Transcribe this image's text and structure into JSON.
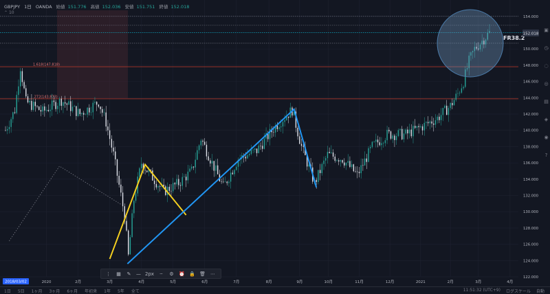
{
  "header": {
    "symbol": "GBPJPY",
    "interval": "1日",
    "broker": "OANDA",
    "open_label": "始値",
    "open_value": "151.776",
    "high_label": "高値",
    "high_value": "152.036",
    "low_label": "安値",
    "low_value": "151.751",
    "close_label": "終値",
    "close_value": "152.018",
    "indicator": "10"
  },
  "toolbar": {
    "width_label": "2px"
  },
  "bottom_bar": {
    "ranges": [
      "1日",
      "5日",
      "1ヶ月",
      "3ヶ月",
      "6ヶ月",
      "年初来",
      "1年",
      "5年",
      "全て"
    ],
    "time": "11:51:32 (UTC+9)",
    "scale_label": "ログスケール",
    "auto_label": "自動"
  },
  "colors": {
    "background": "#131722",
    "grid": "#1e2230",
    "candle_up": "#26a69a",
    "candle_down": "#e0e3eb",
    "fib_line": "#c0392b",
    "price_line": "#00bcd4",
    "yellow": "#f5d020",
    "blue": "#2196f3"
  },
  "chart_data": {
    "type": "candlestick",
    "instrument": "GBPJPY",
    "timeframe": "1日",
    "x_axis": {
      "ticks": [
        "2018/03/02",
        "2020",
        "2月",
        "3月",
        "4月",
        "5月",
        "6月",
        "7月",
        "8月",
        "9月",
        "10月",
        "11月",
        "12月",
        "2021",
        "2月",
        "3月",
        "4月"
      ]
    },
    "y_axis": {
      "range": [
        122,
        155
      ],
      "ticks": [
        122,
        124,
        126,
        128,
        130,
        132,
        134,
        136,
        138,
        140,
        142,
        144,
        146,
        148,
        150,
        152,
        154
      ],
      "label_format": "0.000"
    },
    "last_price": "152.018",
    "series": [
      {
        "name": "",
        "anchors": [
          {
            "t": 0,
            "v": 140.0
          },
          {
            "t": 10,
            "v": 142.5
          },
          {
            "t": 16,
            "v": 147.8
          },
          {
            "t": 22,
            "v": 143.5
          },
          {
            "t": 40,
            "v": 142.3
          },
          {
            "t": 60,
            "v": 143.7
          },
          {
            "t": 80,
            "v": 142.0
          },
          {
            "t": 100,
            "v": 143.5
          },
          {
            "t": 108,
            "v": 141.0
          },
          {
            "t": 116,
            "v": 137.0
          },
          {
            "t": 128,
            "v": 129.5
          },
          {
            "t": 132,
            "v": 124.5
          },
          {
            "t": 138,
            "v": 131.5
          },
          {
            "t": 146,
            "v": 136.0
          },
          {
            "t": 156,
            "v": 134.5
          },
          {
            "t": 170,
            "v": 132.5
          },
          {
            "t": 186,
            "v": 133.5
          },
          {
            "t": 200,
            "v": 135.0
          },
          {
            "t": 210,
            "v": 139.0
          },
          {
            "t": 222,
            "v": 136.0
          },
          {
            "t": 234,
            "v": 133.0
          },
          {
            "t": 250,
            "v": 136.5
          },
          {
            "t": 270,
            "v": 137.5
          },
          {
            "t": 290,
            "v": 140.5
          },
          {
            "t": 308,
            "v": 142.5
          },
          {
            "t": 318,
            "v": 138.0
          },
          {
            "t": 332,
            "v": 133.5
          },
          {
            "t": 346,
            "v": 137.0
          },
          {
            "t": 362,
            "v": 136.5
          },
          {
            "t": 378,
            "v": 134.5
          },
          {
            "t": 394,
            "v": 138.0
          },
          {
            "t": 410,
            "v": 139.5
          },
          {
            "t": 430,
            "v": 139.5
          },
          {
            "t": 448,
            "v": 140.5
          },
          {
            "t": 464,
            "v": 141.5
          },
          {
            "t": 478,
            "v": 143.0
          },
          {
            "t": 486,
            "v": 144.5
          },
          {
            "t": 492,
            "v": 146.0
          },
          {
            "t": 498,
            "v": 148.5
          },
          {
            "t": 504,
            "v": 150.0
          },
          {
            "t": 512,
            "v": 151.0
          },
          {
            "t": 520,
            "v": 152.0
          }
        ]
      }
    ],
    "annotations": {
      "fib_levels": [
        {
          "label": "1.618(147.818)",
          "value": 147.818
        },
        {
          "label": ".272(143.873)",
          "value": 143.873
        }
      ],
      "fr_label": "FR38.2",
      "horizontal_levels": [
        154.0,
        152.9,
        150.7
      ],
      "yellow_wave": [
        {
          "t": 112,
          "v": 124.2
        },
        {
          "t": 150,
          "v": 135.8
        },
        {
          "t": 194,
          "v": 129.6
        }
      ],
      "blue_wave": [
        {
          "t": 131,
          "v": 123.6
        },
        {
          "t": 310,
          "v": 142.6
        },
        {
          "t": 334,
          "v": 133.0
        }
      ],
      "dotted_line": [
        {
          "t": 4,
          "v": 126.4
        },
        {
          "t": 58,
          "v": 135.6
        },
        {
          "t": 124,
          "v": 130.9
        }
      ]
    }
  }
}
